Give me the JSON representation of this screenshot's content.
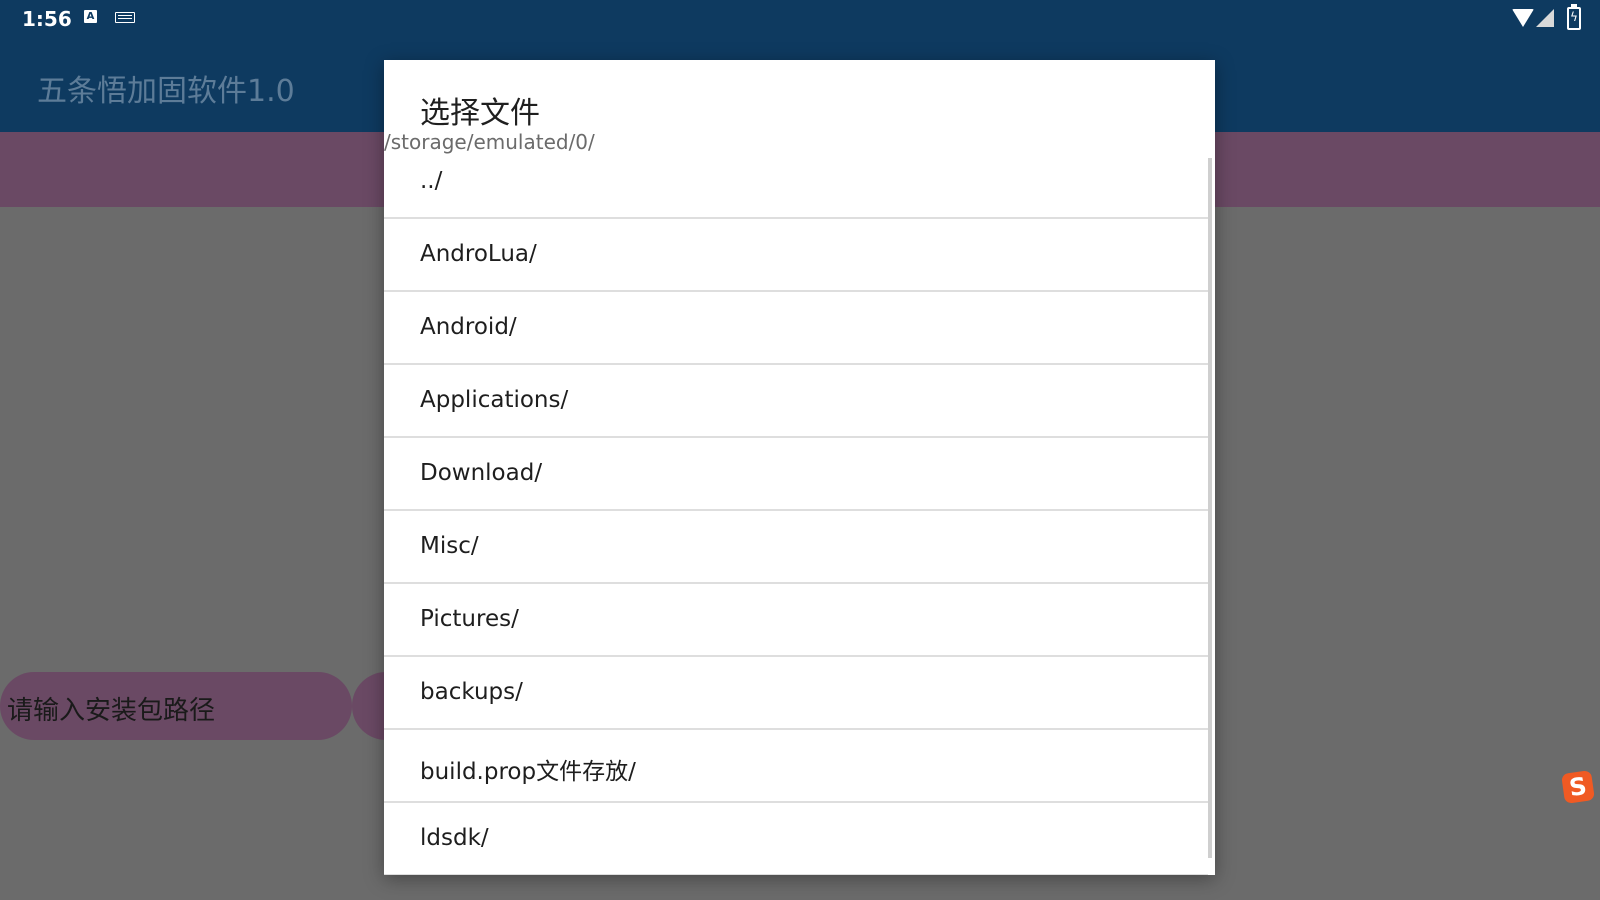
{
  "status_bar": {
    "time": "1:56",
    "icons": [
      "keyboard-a-icon",
      "keyboard-icon",
      "wifi-icon",
      "signal-icon",
      "battery-charging-icon"
    ]
  },
  "app": {
    "title": "五条悟加固软件1.0"
  },
  "main": {
    "path_input_placeholder": "请输入安装包路径"
  },
  "dialog": {
    "title": "选择文件",
    "path": "/storage/emulated/0/",
    "items": [
      "../",
      "AndroLua/",
      "Android/",
      "Applications/",
      "Download/",
      "Misc/",
      "Pictures/",
      "backups/",
      "build.prop文件存放/",
      "ldsdk/"
    ]
  },
  "floating": {
    "ime_icon": "S"
  },
  "colors": {
    "app_bar": "#0e3a60",
    "accent_purple": "#6a4964",
    "scrim": "#6b6b6b",
    "dialog_bg": "#ffffff"
  }
}
